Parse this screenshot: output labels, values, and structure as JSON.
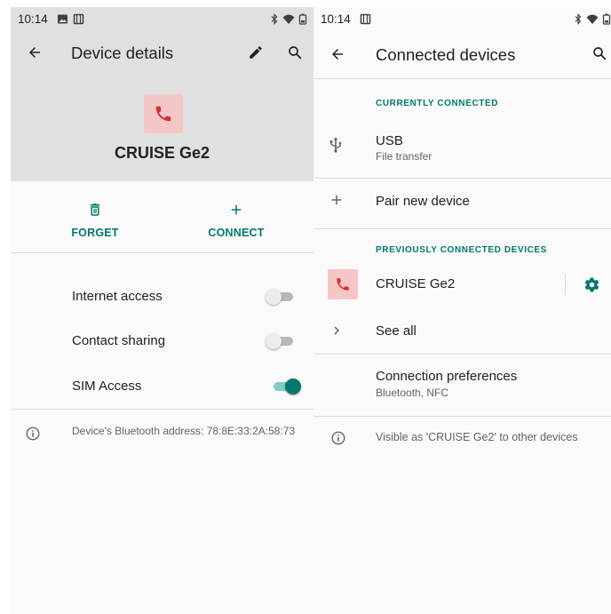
{
  "left": {
    "status": {
      "time": "10:14"
    },
    "title": "Device details",
    "device_name": "CRUISE Ge2",
    "actions": {
      "forget": "FORGET",
      "connect": "CONNECT"
    },
    "settings": [
      {
        "label": "Internet access",
        "enabled": false
      },
      {
        "label": "Contact sharing",
        "enabled": false
      },
      {
        "label": "SIM Access",
        "enabled": true
      }
    ],
    "address_info": "Device's Bluetooth address: 78:8E:33:2A:58:73"
  },
  "right": {
    "status": {
      "time": "10:14"
    },
    "title": "Connected devices",
    "currently_connected_header": "CURRENTLY CONNECTED",
    "usb": {
      "title": "USB",
      "subtitle": "File transfer"
    },
    "pair_new": "Pair new device",
    "previously_connected_header": "PREVIOUSLY CONNECTED DEVICES",
    "previous_device": "CRUISE Ge2",
    "see_all": "See all",
    "connection_prefs": {
      "title": "Connection preferences",
      "subtitle": "Bluetooth, NFC"
    },
    "visibility_info": "Visible as 'CRUISE Ge2' to other devices"
  },
  "colors": {
    "accent": "#00796b",
    "header_bg": "#e0e0e0",
    "phone_icon": "#d32f2f",
    "avatar_bg": "#f5c6c6"
  },
  "icons": [
    "back-arrow-icon",
    "edit-pencil-icon",
    "search-icon",
    "phone-icon",
    "trash-icon",
    "plus-icon",
    "info-icon",
    "usb-icon",
    "chevron-right-icon",
    "gear-icon"
  ]
}
